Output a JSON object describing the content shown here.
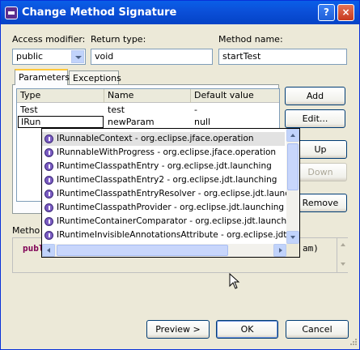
{
  "window": {
    "title": "Change Method Signature",
    "help_label": "?",
    "close_label": "×"
  },
  "access_modifier": {
    "label": "Access modifier:",
    "value": "public"
  },
  "return_type": {
    "label": "Return type:",
    "value": "void"
  },
  "method_name": {
    "label": "Method name:",
    "value": "startTest"
  },
  "tabs": [
    {
      "label": "Parameters",
      "active": true
    },
    {
      "label": "Exceptions",
      "active": false
    }
  ],
  "params_table": {
    "columns": [
      "Type",
      "Name",
      "Default value"
    ],
    "rows": [
      {
        "type": "Test",
        "name": "test",
        "default": "-"
      },
      {
        "type": "IRun",
        "name": "newParam",
        "default": "null"
      }
    ]
  },
  "side_buttons": {
    "add": "Add",
    "edit": "Edit...",
    "up": "Up",
    "down": "Down",
    "remove": "Remove"
  },
  "autocomplete": {
    "items": [
      "IRunnableContext - org.eclipse.jface.operation",
      "IRunnableWithProgress - org.eclipse.jface.operation",
      "IRuntimeClasspathEntry - org.eclipse.jdt.launching",
      "IRuntimeClasspathEntry2 - org.eclipse.jdt.launching",
      "IRuntimeClasspathEntryResolver - org.eclipse.jdt.launchin",
      "IRuntimeClasspathProvider - org.eclipse.jdt.launching",
      "IRuntimeContainerComparator - org.eclipse.jdt.launching",
      "IRuntimeInvisibleAnnotationsAttribute - org.eclipse.jdt.cor"
    ],
    "selected_index": 0
  },
  "preview": {
    "label": "Metho",
    "code_keyword": "publ",
    "code_tail": "am)"
  },
  "bottom_buttons": {
    "preview": "Preview >",
    "ok": "OK",
    "cancel": "Cancel"
  }
}
